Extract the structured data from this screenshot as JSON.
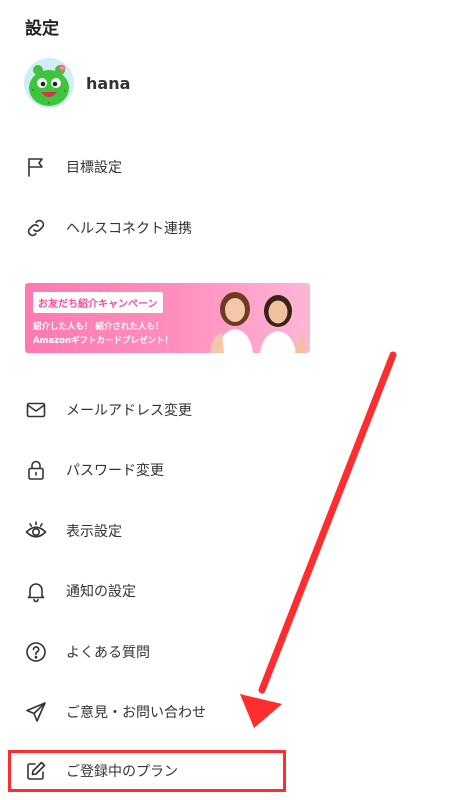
{
  "header": {
    "title": "設定"
  },
  "profile": {
    "username": "hana"
  },
  "menu_top": [
    {
      "label": "目標設定",
      "icon": "flag-icon"
    },
    {
      "label": "ヘルスコネクト連携",
      "icon": "link-icon"
    }
  ],
  "banner": {
    "tag": "お友だち紹介キャンペーン",
    "line1": "紹介した人も！ 紹介された人も！",
    "line2": "Amazonギフトカードプレゼント！"
  },
  "menu_bottom": [
    {
      "label": "メールアドレス変更",
      "icon": "mail-icon"
    },
    {
      "label": "パスワード変更",
      "icon": "lock-icon"
    },
    {
      "label": "表示設定",
      "icon": "eye-icon"
    },
    {
      "label": "通知の設定",
      "icon": "bell-icon"
    },
    {
      "label": "よくある質問",
      "icon": "question-circle-icon"
    },
    {
      "label": "ご意見・お問い合わせ",
      "icon": "paper-plane-icon"
    },
    {
      "label": "ご登録中のプラン",
      "icon": "edit-icon"
    }
  ],
  "colors": {
    "annotation_red": "#ff2d2d",
    "banner_pink": "#ff79b0",
    "avatar_green": "#3ec43e"
  }
}
